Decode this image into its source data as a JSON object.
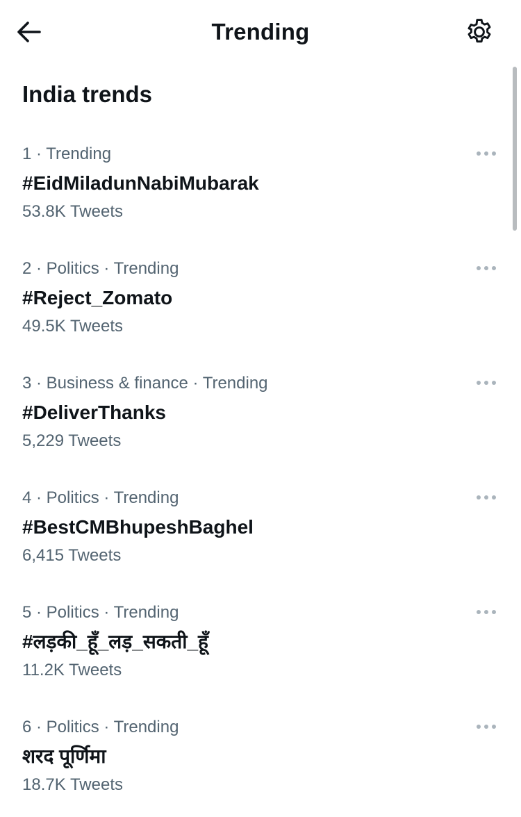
{
  "header": {
    "title": "Trending",
    "back_icon": "arrow-left-icon",
    "settings_icon": "gear-icon"
  },
  "section": {
    "title": "India trends"
  },
  "colors": {
    "primary_text": "#0f1419",
    "secondary_text": "#536471",
    "more_dots": "#aab4bc",
    "scrollbar": "#b8bcbf"
  },
  "trends": [
    {
      "meta": "1 · Trending",
      "name": "#EidMiladunNabiMubarak",
      "count": "53.8K Tweets"
    },
    {
      "meta": "2 · Politics · Trending",
      "name": "#Reject_Zomato",
      "count": "49.5K Tweets"
    },
    {
      "meta": "3 · Business & finance · Trending",
      "name": "#DeliverThanks",
      "count": "5,229 Tweets"
    },
    {
      "meta": "4 · Politics · Trending",
      "name": "#BestCMBhupeshBaghel",
      "count": "6,415 Tweets"
    },
    {
      "meta": "5 · Politics · Trending",
      "name": "#लड़की_हूँ_लड़_सकती_हूँ",
      "count": "11.2K Tweets"
    },
    {
      "meta": "6 · Politics · Trending",
      "name": "शरद पूर्णिमा",
      "count": "18.7K Tweets"
    }
  ]
}
